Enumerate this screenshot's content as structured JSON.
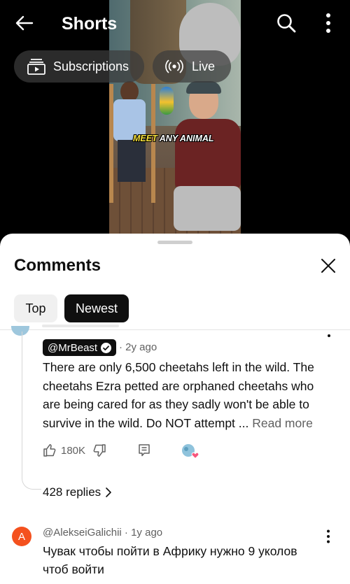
{
  "header": {
    "title": "Shorts"
  },
  "chips": {
    "subscriptions": "Subscriptions",
    "live": "Live"
  },
  "video": {
    "caption_highlight": "MEET",
    "caption_rest": "ANY ANIMAL"
  },
  "comments": {
    "title": "Comments",
    "sort": {
      "top": "Top",
      "newest": "Newest"
    },
    "items": [
      {
        "author": "@MrBeast",
        "verified": true,
        "time": "· 2y ago",
        "text": "There are only 6,500 cheetahs left in the wild. The cheetahs Ezra petted are orphaned cheetahs who are being cared for as they sadly won't be able to survive in the wild. Do NOT attempt ... ",
        "read_more": "Read more",
        "likes": "180K",
        "replies": "428 replies"
      },
      {
        "avatar_letter": "A",
        "author_meta": "@AlekseiGalichii · 1y ago",
        "text": "Чувак чтобы пойти в Африку нужно 9 уколов чтоб войти"
      }
    ]
  },
  "colors": {
    "accent_dark": "#0f0f0f",
    "avatar_orange": "#f4511e",
    "secondary_text": "#606060"
  }
}
